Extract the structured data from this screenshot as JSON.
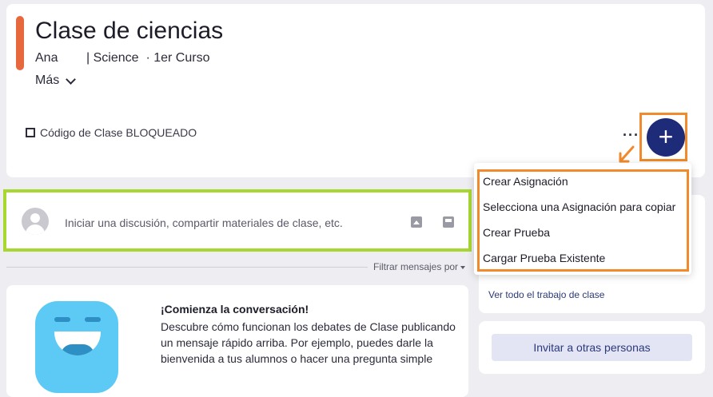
{
  "header": {
    "class_title": "Clase de ciencias",
    "teacher": "Ana",
    "subject": "| Science",
    "grade": "· 1er Curso",
    "more_label": "Más",
    "class_code": "Código de Clase BLOQUEADO",
    "more_options": "···",
    "add_label": "+"
  },
  "menu": {
    "items": [
      "Crear Asignación",
      "Selecciona una Asignación para copiar",
      "Crear Prueba",
      "Cargar Prueba Existente"
    ]
  },
  "composer": {
    "prompt": "Iniciar una discusión, compartir materiales de clase, etc."
  },
  "filter": {
    "label": "Filtrar mensajes por"
  },
  "conversation": {
    "title": "¡Comienza la conversación!",
    "body": "Descubre cómo funcionan los debates de Clase publicando un mensaje rápido arriba. Por ejemplo, puedes darle la bienvenida a tus alumnos o hacer una pregunta simple"
  },
  "sidebar": {
    "view_all": "Ver todo el trabajo de clase",
    "invite": "Invitar a otras personas"
  },
  "colors": {
    "accent": "#e8683e",
    "primary": "#1e2b78",
    "highlight_orange": "#f08a2c",
    "highlight_green": "#a8d732"
  },
  "icons": [
    "scan-code-icon",
    "more-dots-icon",
    "plus-icon",
    "chevron-down-icon",
    "avatar-icon",
    "image-icon",
    "materials-icon",
    "chat-mascot-icon"
  ]
}
